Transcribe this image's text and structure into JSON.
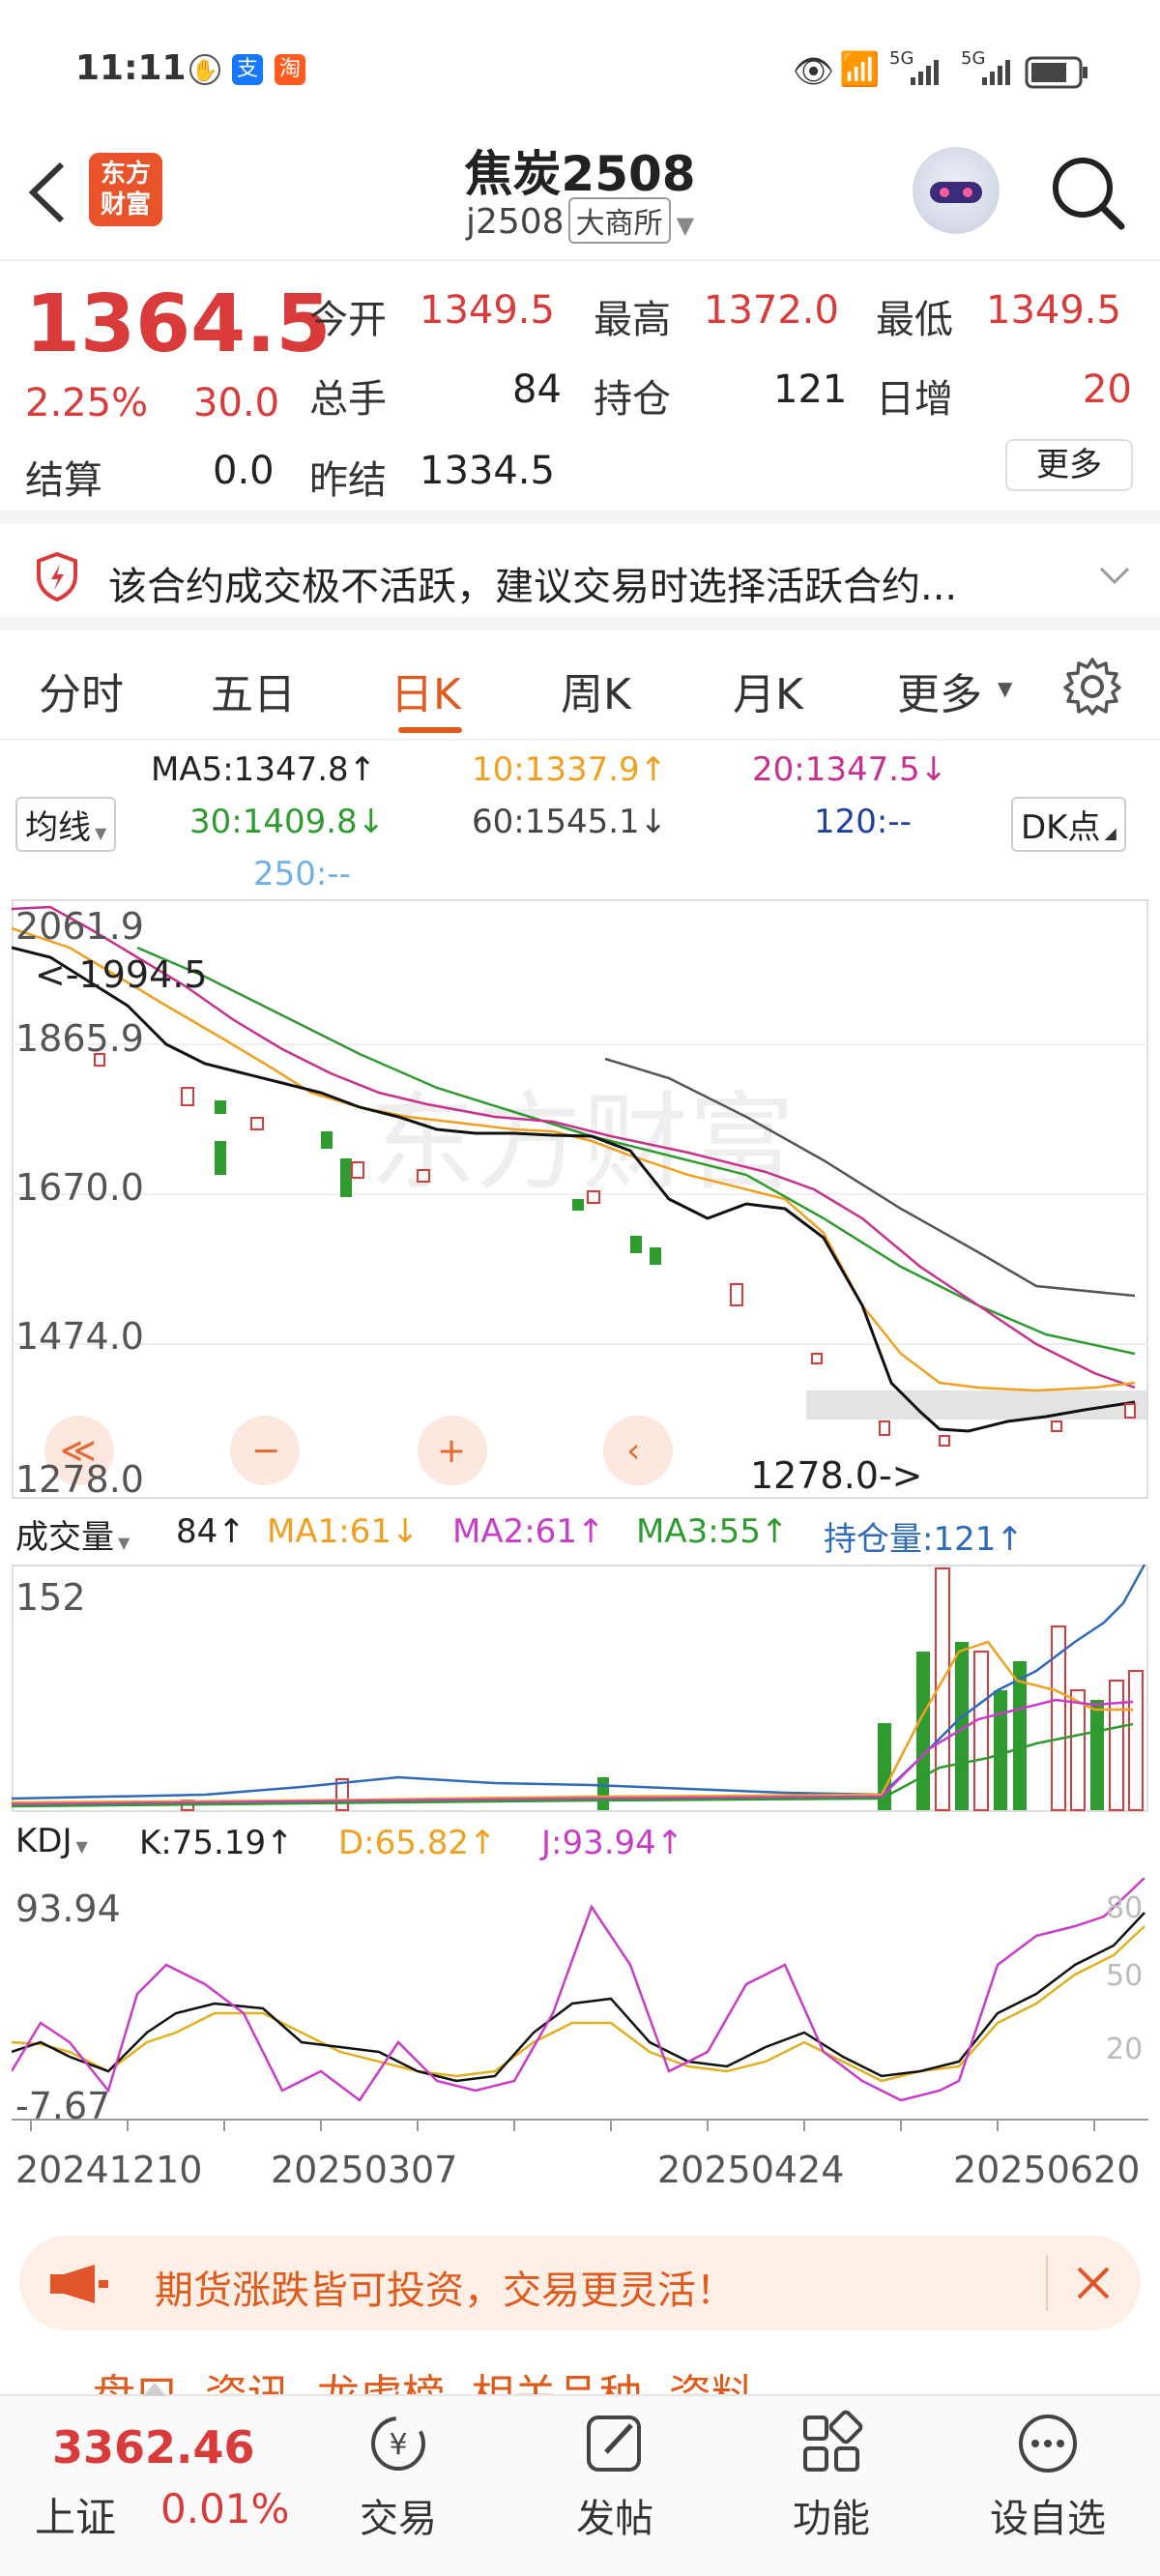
{
  "status_bar": {
    "time": "11:11",
    "signal_a": "5G",
    "signal_b": "5G"
  },
  "header": {
    "logo": "东方\n财富",
    "title": "焦炭2508",
    "code": "j2508",
    "exchange": "大商所"
  },
  "quote": {
    "price": "1364.5",
    "pct": "2.25%",
    "chg": "30.0",
    "settle_label": "结算",
    "settle": "0.0",
    "rows": [
      {
        "l1": "今开",
        "v1": "1349.5",
        "l2": "最高",
        "v2": "1372.0",
        "l3": "最低",
        "v3": "1349.5"
      },
      {
        "l1": "总手",
        "v1": "84",
        "l2": "持仓",
        "v2": "121",
        "l3": "日增",
        "v3": "20"
      }
    ],
    "prev_label": "昨结",
    "prev": "1334.5",
    "more": "更多"
  },
  "warning": {
    "text": "该合约成交极不活跃，建议交易时选择活跃合约..."
  },
  "tabs": [
    "分时",
    "五日",
    "日K",
    "周K",
    "月K",
    "更多"
  ],
  "ma_legend": {
    "dropdown": "均线",
    "ma5": "MA5:1347.8↑",
    "ma10": "10:1337.9↑",
    "ma20": "20:1347.5↓",
    "ma30": "30:1409.8↓",
    "ma60": "60:1545.1↓",
    "ma120": "120:--",
    "ma250": "250:--",
    "dk": "DK点"
  },
  "kline": {
    "yticks": [
      "2061.9",
      "1865.9",
      "1670.0",
      "1474.0",
      "1278.0"
    ],
    "high_marker": "<-1994.5",
    "low_marker": "1278.0->"
  },
  "volume": {
    "dropdown": "成交量",
    "v": "84↑",
    "ma1": "MA1:61↓",
    "ma2": "MA2:61↑",
    "ma3": "MA3:55↑",
    "oi": "持仓量:121↑",
    "ymax": "152"
  },
  "kdj": {
    "dropdown": "KDJ",
    "k": "K:75.19↑",
    "d": "D:65.82↑",
    "j": "J:93.94↑",
    "ymax": "93.94",
    "ymin": "-7.67",
    "r80": "80",
    "r50": "50",
    "r20": "20"
  },
  "dates": [
    "20241210",
    "20250307",
    "20250424",
    "20250620"
  ],
  "promo": {
    "text": "期货涨跌皆可投资，交易更灵活！"
  },
  "peek_tabs": "盘口  资讯  龙虎榜  相关品种  资料",
  "bottom": {
    "index_value": "3362.46",
    "index_name": "上证",
    "index_pct": "0.01%",
    "nav": [
      "交易",
      "发帖",
      "功能",
      "设自选"
    ]
  },
  "colors": {
    "up": "#d93a3a",
    "down": "#2f9a2f",
    "accent": "#e05a1c",
    "ma10": "#f0a020",
    "ma20": "#c8308e",
    "ma30": "#2f9a2f",
    "ma120": "#2040a0",
    "ma250": "#6fb0e6"
  }
}
